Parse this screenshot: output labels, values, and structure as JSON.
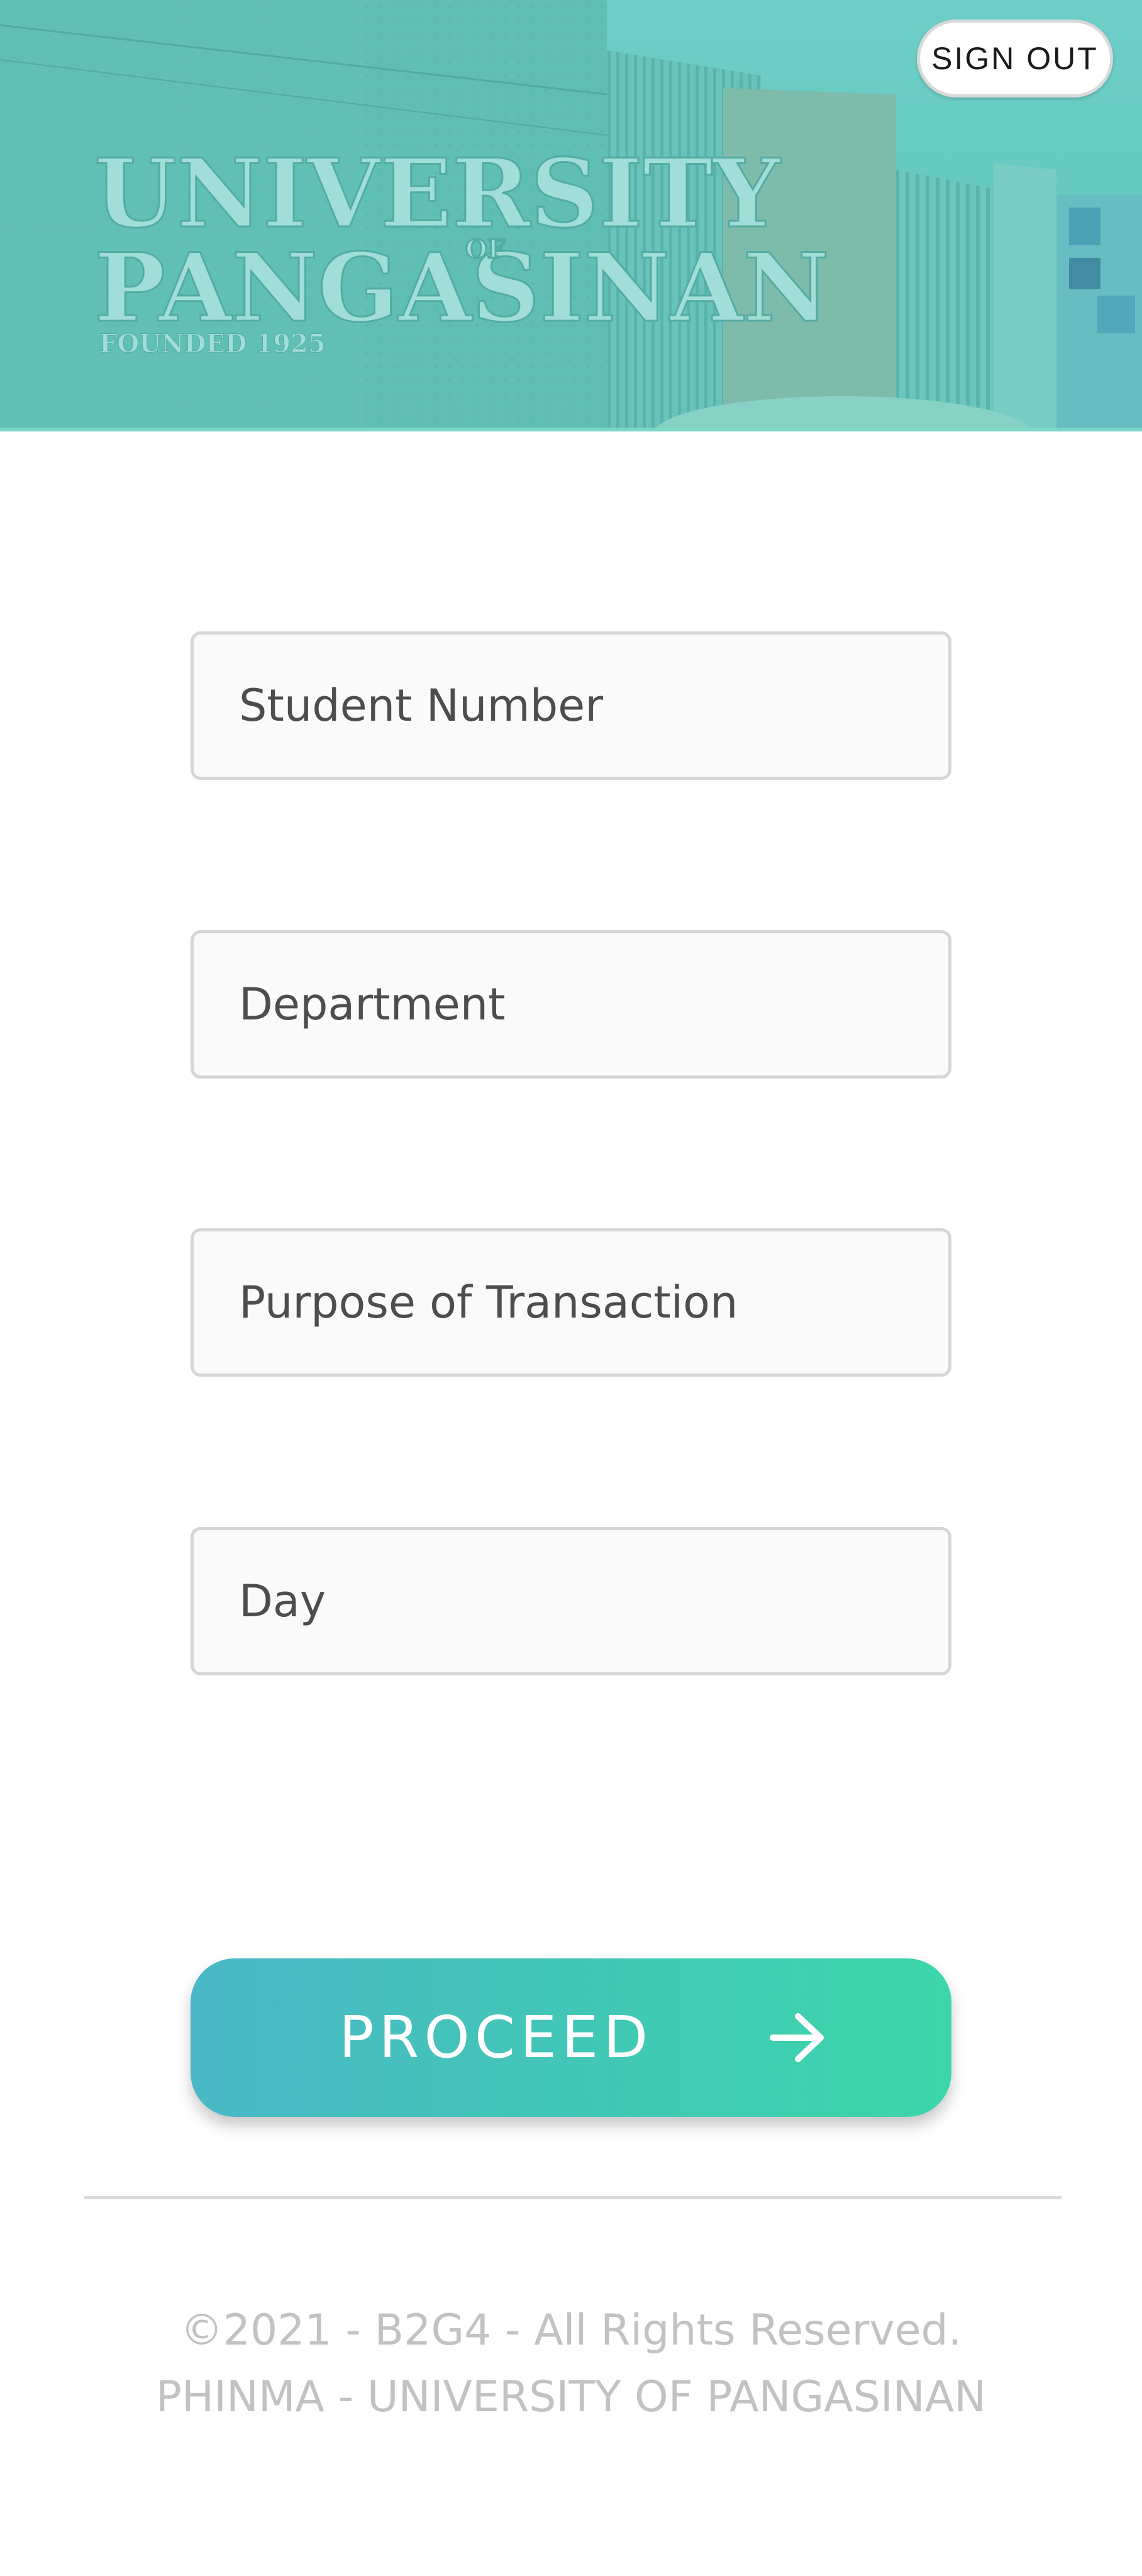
{
  "header": {
    "sign_out_label": "SIGN OUT",
    "banner_sign_line_1": "UNIVERSITY",
    "banner_sign_of": "OF",
    "banner_sign_line_2": "PANGASINAN",
    "banner_sign_founded": "FOUNDED   1925",
    "overlay_color": "#5cc7bd"
  },
  "form": {
    "student_number_placeholder": "Student Number",
    "department_placeholder": "Department",
    "purpose_placeholder": "Purpose of Transaction",
    "day_placeholder": "Day",
    "proceed_label": "PROCEED",
    "proceed_icon": "arrow-right-icon"
  },
  "footer": {
    "copyright": "©2021 - B2G4 - All Rights Reserved.",
    "institution": "PHINMA - UNIVERSITY OF PANGASINAN"
  }
}
